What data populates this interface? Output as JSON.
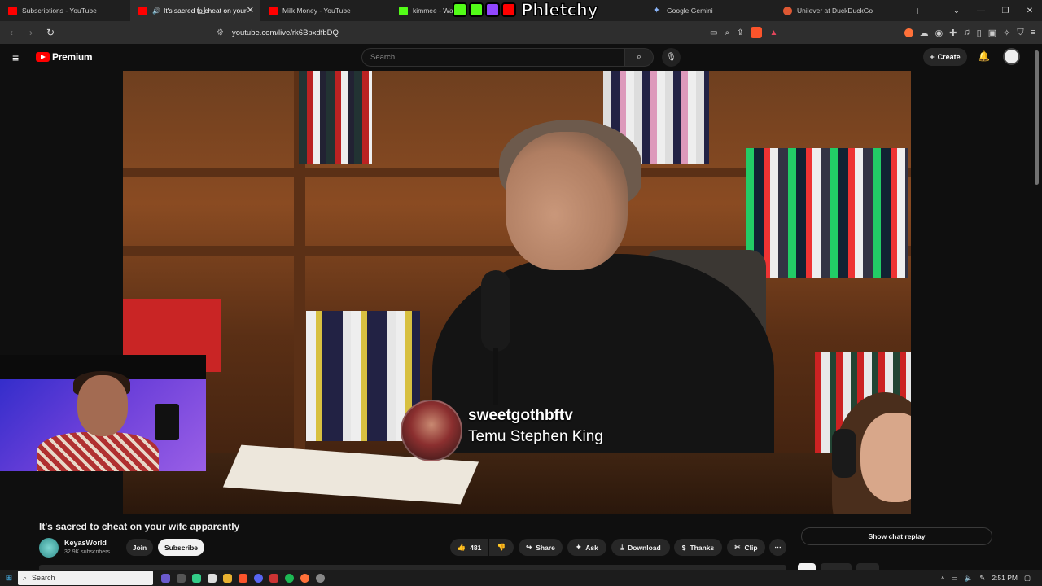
{
  "browser": {
    "tabs": [
      {
        "title": "Subscriptions - YouTube",
        "favicon": "youtube-icon",
        "active": false
      },
      {
        "title": "It's sacred to cheat on your",
        "favicon": "youtube-icon",
        "active": true,
        "audio": true
      },
      {
        "title": "Milk Money - YouTube",
        "favicon": "youtube-icon",
        "active": false
      },
      {
        "title": "kimmee - Watc",
        "favicon": "kick-icon",
        "active": false
      },
      {
        "title": "Google Gemini",
        "favicon": "gemini-icon",
        "active": false
      },
      {
        "title": "Unilever at DuckDuckGo",
        "favicon": "duckduckgo-icon",
        "active": false
      }
    ],
    "url": "youtube.com/live/rk6BpxdfbDQ",
    "overlay_logo": "Phletchy",
    "shield_count": "1"
  },
  "youtube": {
    "brand": "Premium",
    "search_placeholder": "Search",
    "create_label": "Create"
  },
  "video": {
    "chat_badge_user": "sweetgothbftv",
    "chat_badge_message": "Temu Stephen King"
  },
  "info": {
    "title": "It's sacred to cheat on your wife apparently",
    "channel": "KeyasWorld",
    "subscribers": "32.9K subscribers",
    "join_label": "Join",
    "subscribe_label": "Subscribe",
    "likes": "481",
    "share_label": "Share",
    "ask_label": "Ask",
    "download_label": "Download",
    "thanks_label": "Thanks",
    "clip_label": "Clip",
    "chat_replay_label": "Show chat replay"
  },
  "taskbar": {
    "search_placeholder": "Search",
    "time": "2:51 PM"
  },
  "colors": {
    "youtube_red": "#ff0000",
    "background": "#0f0f0f",
    "kick_green": "#53fc18"
  }
}
